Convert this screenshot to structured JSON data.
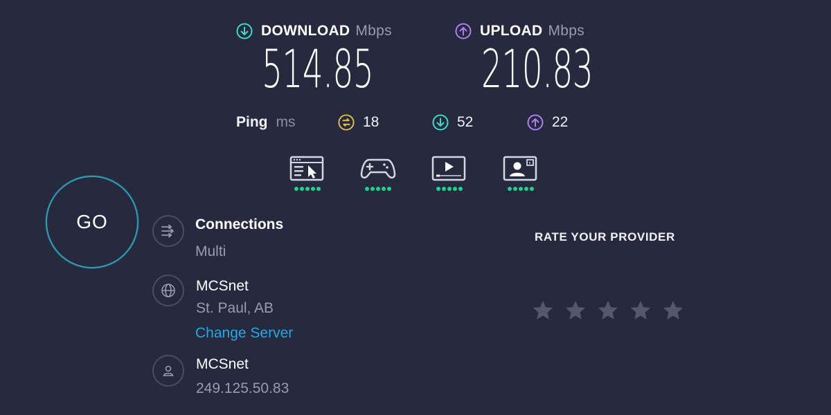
{
  "download": {
    "label": "DOWNLOAD",
    "unit": "Mbps",
    "value": "514.85",
    "icon": "arrow-down-circle-icon",
    "color": "#3fd9c9"
  },
  "upload": {
    "label": "UPLOAD",
    "unit": "Mbps",
    "value": "210.83",
    "icon": "arrow-up-circle-icon",
    "color": "#b27cf4"
  },
  "ping": {
    "label": "Ping",
    "unit": "ms",
    "idle": {
      "value": "18",
      "icon": "ping-idle-icon",
      "color": "#e8c64e"
    },
    "download": {
      "value": "52",
      "icon": "arrow-down-circle-icon",
      "color": "#3fd9c9"
    },
    "upload": {
      "value": "22",
      "icon": "arrow-up-circle-icon",
      "color": "#b27cf4"
    }
  },
  "quality_indicators": [
    {
      "icon": "web-browsing-icon",
      "level": 5,
      "max": 5
    },
    {
      "icon": "gaming-controller-icon",
      "level": 5,
      "max": 5
    },
    {
      "icon": "video-streaming-icon",
      "level": 5,
      "max": 5
    },
    {
      "icon": "video-chat-icon",
      "level": 5,
      "max": 5
    }
  ],
  "go_button": {
    "label": "GO",
    "accent": "#2f9fb8"
  },
  "connections": {
    "icon": "connections-icon",
    "title": "Connections",
    "value": "Multi"
  },
  "server": {
    "icon": "globe-icon",
    "name": "MCSnet",
    "location": "St. Paul, AB",
    "change_label": "Change Server"
  },
  "provider": {
    "icon": "user-icon",
    "name": "MCSnet",
    "ip": "249.125.50.83"
  },
  "rating": {
    "title": "RATE YOUR PROVIDER",
    "stars": 5,
    "selected": 0
  }
}
